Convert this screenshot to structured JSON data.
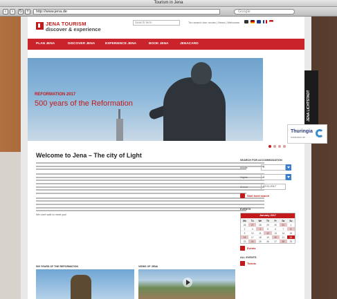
{
  "browser": {
    "window_title": "Tourism in Jena",
    "url": "http://www.jena.de",
    "search_placeholder": "Google"
  },
  "header": {
    "logo_line1": "JENA TOURISM",
    "logo_line2": "discover & experience",
    "search_placeholder": "Search term",
    "top_links": "Too search tour routes | News | Webcams"
  },
  "mainnav": {
    "items": [
      "PLAN JENA",
      "DISCOVER JENA",
      "EXPERIENCE JENA",
      "BOOK JENA",
      "JENACARD"
    ]
  },
  "hero": {
    "small": "REFORMATION 2017",
    "big": "500 years of the Reformation"
  },
  "sidetab": {
    "label": "JENA LICHTSTADT"
  },
  "partner": {
    "name": "Thuringia",
    "tagline": "entdecken.de"
  },
  "welcome": {
    "title": "Welcome to Jena – The city of Light",
    "callout": "We can't wait to meet you!"
  },
  "thumbs": {
    "left_heading": "500 YEARS OF THE REFORMATION",
    "right_heading": "VIEWS OF JENA"
  },
  "booking": {
    "heading": "SEARCH FOR ACCOMMODATION",
    "adults_label": "Adults",
    "adults_value": "2",
    "nights_label": "Nights",
    "nights_value": "1",
    "arrival_label": "Arrival",
    "arrival_value": "22.01.2017",
    "start_search": "Start hotel search"
  },
  "events": {
    "heading": "EVENTS",
    "month": "January 2017",
    "weekdays": [
      "Mo",
      "Tu",
      "We",
      "Th",
      "Fr",
      "Sa",
      "Su"
    ],
    "days": [
      "26",
      "27",
      "28",
      "29",
      "30",
      "31",
      "1",
      "2",
      "3",
      "4",
      "5",
      "6",
      "7",
      "8",
      "9",
      "10",
      "11",
      "12",
      "13",
      "14",
      "15",
      "16",
      "17",
      "18",
      "19",
      "20",
      "21",
      "22",
      "23",
      "24",
      "25",
      "26",
      "27",
      "28",
      "29"
    ],
    "today": "22",
    "events_link": "Events",
    "all_events": "ALL EVENTS",
    "tickets": "Tickets"
  },
  "colors": {
    "brand_red": "#c21a1a",
    "nav_red": "#c9242b"
  }
}
